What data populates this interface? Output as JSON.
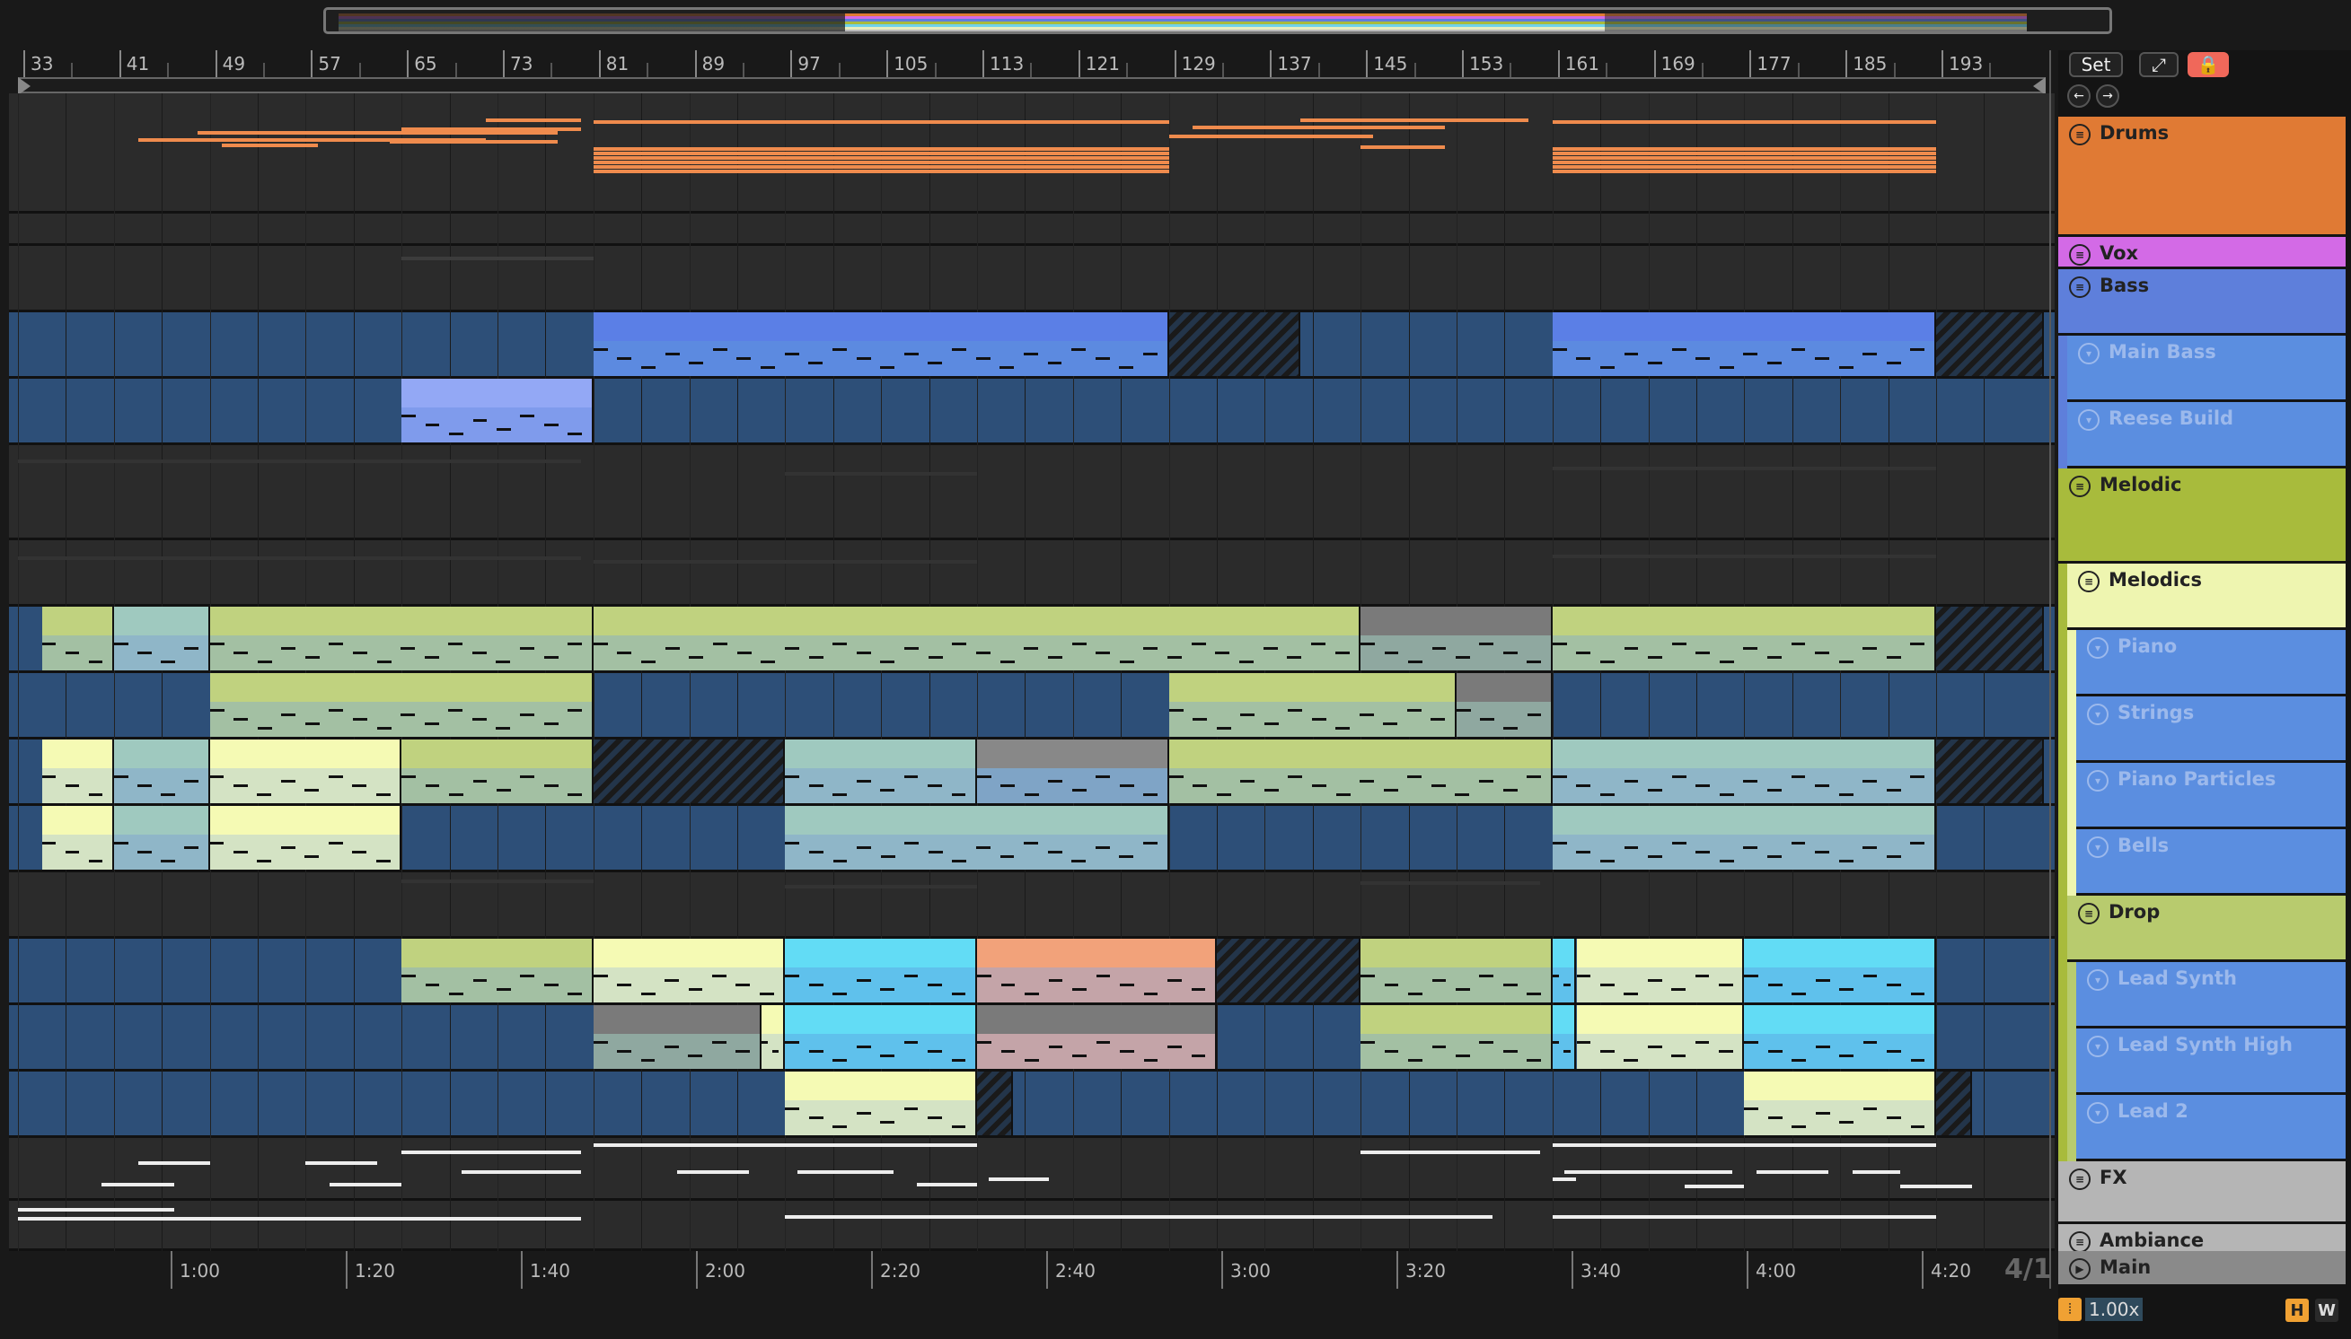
{
  "ruler": {
    "bars": [
      "33",
      "41",
      "49",
      "57",
      "65",
      "73",
      "81",
      "89",
      "97",
      "105",
      "113",
      "121",
      "129",
      "137",
      "145",
      "153",
      "161",
      "169",
      "177",
      "185",
      "193"
    ]
  },
  "timeline": {
    "times": [
      "1:00",
      "1:20",
      "1:40",
      "2:00",
      "2:20",
      "2:40",
      "3:00",
      "3:20",
      "3:40",
      "4:00",
      "4:20"
    ]
  },
  "signature": "4/1",
  "controls": {
    "set_label": "Set",
    "zoom_value": "1.00x",
    "h_label": "H",
    "w_label": "W"
  },
  "tracks": [
    {
      "name": "Drums",
      "color": "#e07a34",
      "kind": "group"
    },
    {
      "name": "Vox",
      "color": "#d36ae6",
      "kind": "group"
    },
    {
      "name": "Bass",
      "color": "#5e7fdb",
      "kind": "group"
    },
    {
      "name": "Main Bass",
      "color": "#5b8ee0",
      "kind": "track"
    },
    {
      "name": "Reese Build",
      "color": "#5b8ee0",
      "kind": "track"
    },
    {
      "name": "Melodic",
      "color": "#a8bb3c",
      "kind": "group"
    },
    {
      "name": "Melodics",
      "color": "#eef5b0",
      "kind": "group"
    },
    {
      "name": "Piano",
      "color": "#5b8ee0",
      "kind": "track"
    },
    {
      "name": "Strings",
      "color": "#5b8ee0",
      "kind": "track"
    },
    {
      "name": "Piano Particles",
      "color": "#5b8ee0",
      "kind": "track"
    },
    {
      "name": "Bells",
      "color": "#5b8ee0",
      "kind": "track"
    },
    {
      "name": "Drop",
      "color": "#b8cb6e",
      "kind": "group"
    },
    {
      "name": "Lead Synth",
      "color": "#5b8ee0",
      "kind": "track"
    },
    {
      "name": "Lead Synth High",
      "color": "#5b8ee0",
      "kind": "track"
    },
    {
      "name": "Lead 2",
      "color": "#5b8ee0",
      "kind": "track"
    },
    {
      "name": "FX",
      "color": "#b5b5b5",
      "kind": "group"
    },
    {
      "name": "Ambiance",
      "color": "#b5b5b5",
      "kind": "group"
    },
    {
      "name": "Main",
      "color": "#8a8a8a",
      "kind": "main"
    }
  ]
}
